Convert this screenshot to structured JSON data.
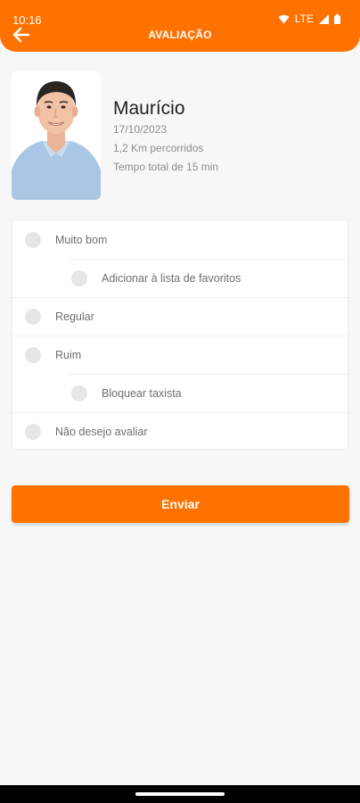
{
  "status_bar": {
    "time": "10:16",
    "network": "LTE"
  },
  "header": {
    "title": "AVALIAÇÃO",
    "back_icon": "arrow-left-icon",
    "color": "#ff7200"
  },
  "driver": {
    "name": "Maurício",
    "date": "17/10/2023",
    "distance": "1,2 Km percorridos",
    "duration": "Tempo total de 15 min"
  },
  "rating_options": [
    {
      "label": "Muito bom"
    },
    {
      "label": "Adicionar à lista de favoritos"
    },
    {
      "label": "Regular"
    },
    {
      "label": "Ruim"
    },
    {
      "label": "Bloquear taxista"
    },
    {
      "label": "Não desejo avaliar"
    }
  ],
  "actions": {
    "send_label": "Enviar"
  }
}
